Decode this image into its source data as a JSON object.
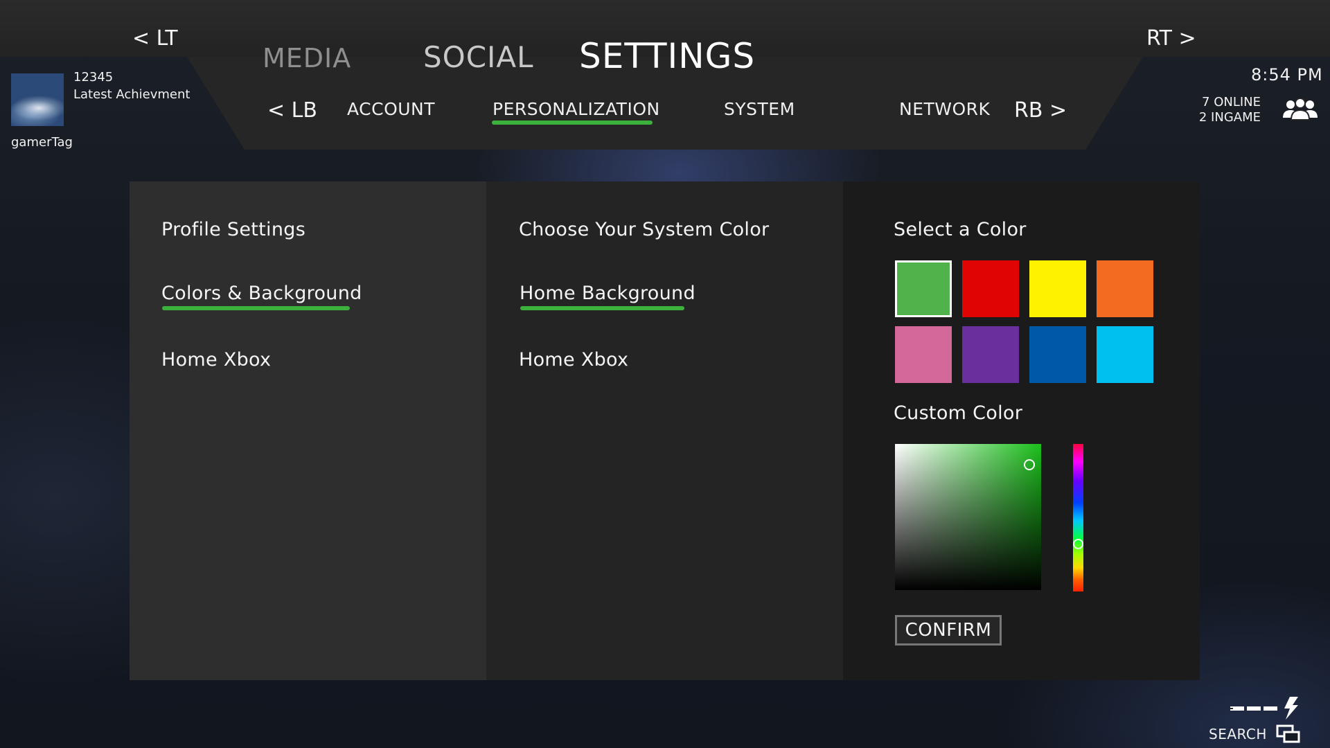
{
  "triggers": {
    "left": "< LT",
    "right": "RT >"
  },
  "main_tabs": [
    {
      "label": "MEDIA",
      "color": "#8f8f8f"
    },
    {
      "label": "SOCIAL",
      "color": "#c8c8c8"
    },
    {
      "label": "SETTINGS",
      "color": "#ffffff",
      "active": true
    }
  ],
  "bumpers": {
    "left": "< LB",
    "right": "RB >"
  },
  "sub_tabs": [
    {
      "label": "ACCOUNT"
    },
    {
      "label": "PERSONALIZATION",
      "active": true
    },
    {
      "label": "SYSTEM"
    },
    {
      "label": "NETWORK"
    }
  ],
  "profile": {
    "score": "12345",
    "achievement": "Latest Achievment",
    "gamertag": "gamerTag"
  },
  "status": {
    "time": "8:54 PM",
    "online": "7 ONLINE",
    "ingame": "2 INGAME"
  },
  "panel1": {
    "items": [
      "Profile Settings",
      "Colors & Background",
      "Home Xbox"
    ],
    "selected_index": 1
  },
  "panel2": {
    "items": [
      "Choose Your System Color",
      "Home Background",
      "Home Xbox"
    ],
    "selected_index": 1
  },
  "panel3": {
    "title": "Select a Color",
    "swatches": [
      "#4fb24a",
      "#e00404",
      "#fff200",
      "#f36a21",
      "#d3689b",
      "#6a2f9c",
      "#0058a8",
      "#00c0ef"
    ],
    "selected_swatch": 0,
    "custom_title": "Custom Color",
    "confirm_label": "CONFIRM"
  },
  "search_label": "SEARCH",
  "colors": {
    "accent": "#3cb23c"
  }
}
